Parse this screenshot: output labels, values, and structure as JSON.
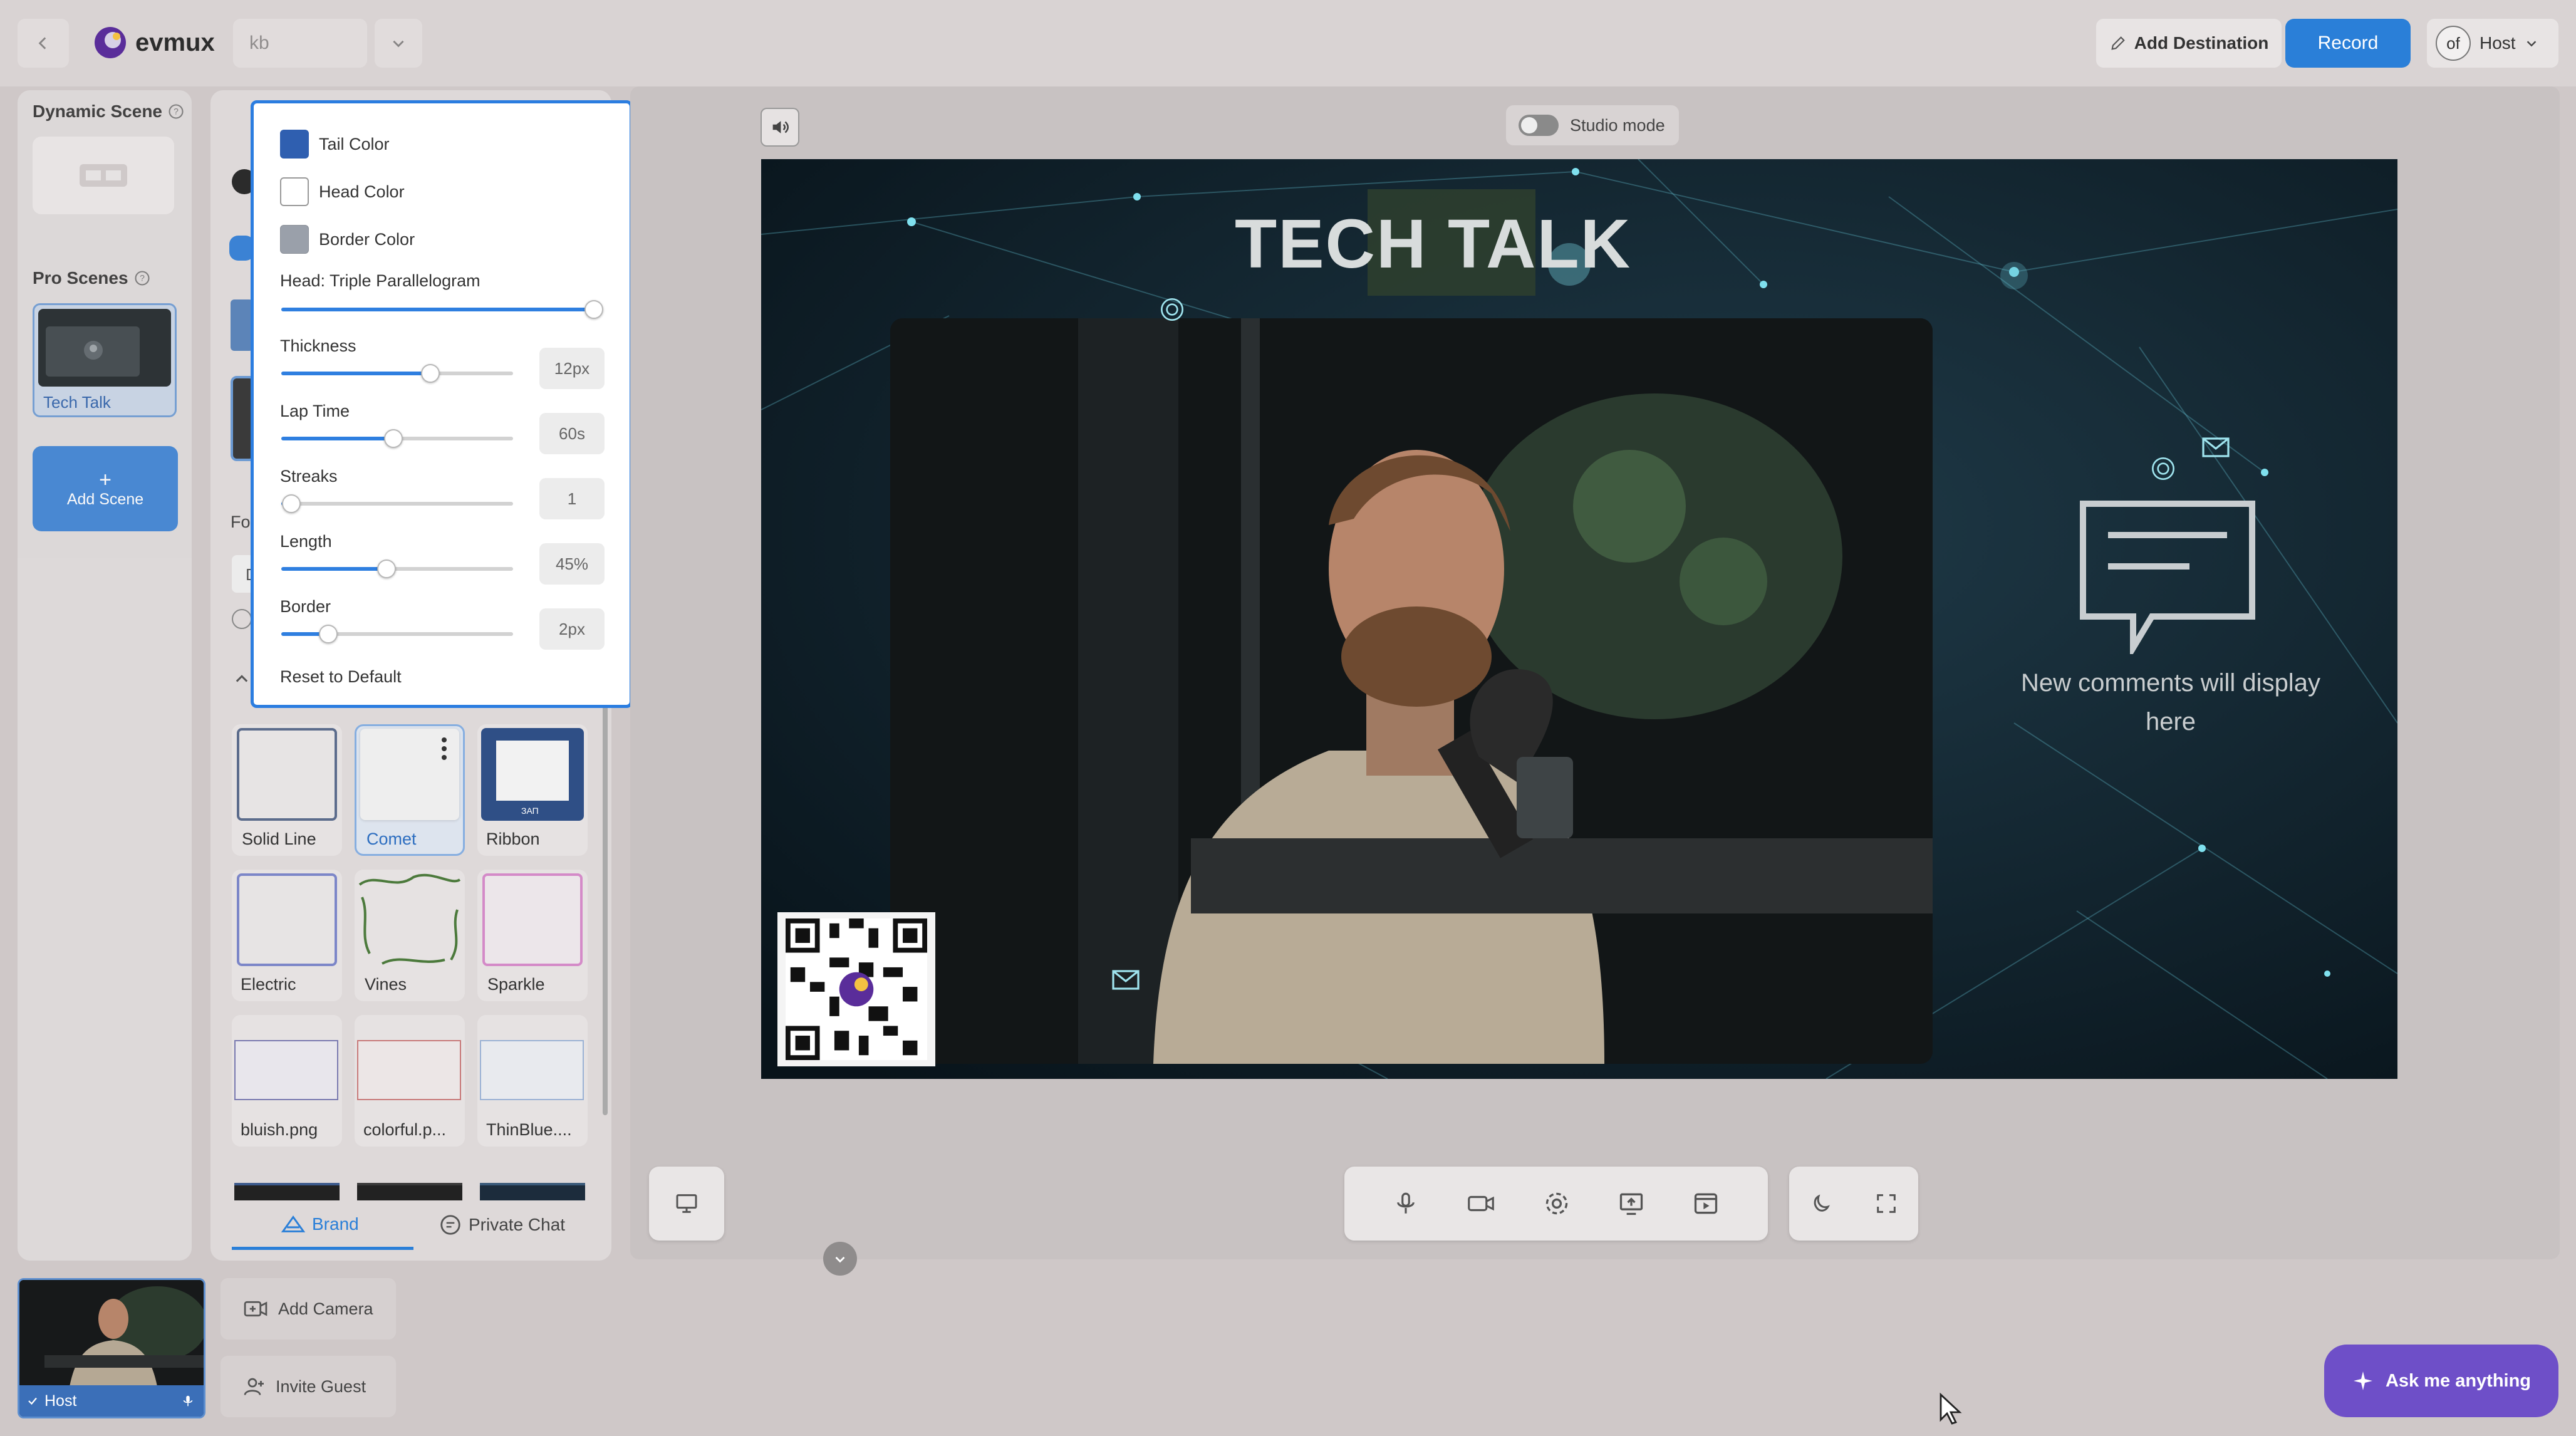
{
  "topbar": {
    "brand": "evmux",
    "project_input": "kb",
    "add_destination": "Add Destination",
    "record": "Record",
    "avatar_text": "of",
    "user": "Host"
  },
  "scenes": {
    "dynamic_title": "Dynamic Scene",
    "pro_title": "Pro Scenes",
    "pro_item": "Tech Talk",
    "add_scene": "Add Scene",
    "add_scene_plus": "+"
  },
  "popover": {
    "tail_color": "Tail Color",
    "head_color": "Head Color",
    "border_color": "Border Color",
    "head_label": "Head: Triple Parallelogram",
    "head_progress": 1.0,
    "sliders": [
      {
        "label": "Thickness",
        "value": "12px",
        "pct": 0.64
      },
      {
        "label": "Lap Time",
        "value": "60s",
        "pct": 0.48
      },
      {
        "label": "Streaks",
        "value": "1",
        "pct": 0.04
      },
      {
        "label": "Length",
        "value": "45%",
        "pct": 0.45
      },
      {
        "label": "Border",
        "value": "2px",
        "pct": 0.2
      }
    ],
    "reset": "Reset to Default",
    "colors": {
      "tail": "#2f5fb0",
      "head": "#ffffff",
      "border": "#9aa0aa"
    }
  },
  "side_partial": {
    "fo_label": "Fo",
    "d_label": "D"
  },
  "borders": {
    "tiles": [
      {
        "label": "Solid Line"
      },
      {
        "label": "Comet"
      },
      {
        "label": "Ribbon"
      },
      {
        "label": "Electric"
      },
      {
        "label": "Vines"
      },
      {
        "label": "Sparkle"
      },
      {
        "label": "bluish.png"
      },
      {
        "label": "colorful.p..."
      },
      {
        "label": "ThinBlue...."
      }
    ],
    "ribbon_text": "ЗАП"
  },
  "bottom_tabs": {
    "brand": "Brand",
    "private_chat": "Private Chat"
  },
  "stage": {
    "studio_mode": "Studio mode",
    "title_overlay": "TECH TALK",
    "comments_line1": "New comments will display",
    "comments_line2": "here"
  },
  "footer": {
    "host_label": "Host",
    "add_camera": "Add Camera",
    "invite_guest": "Invite Guest",
    "ask": "Ask me anything"
  },
  "accent": "#2a7fd8"
}
